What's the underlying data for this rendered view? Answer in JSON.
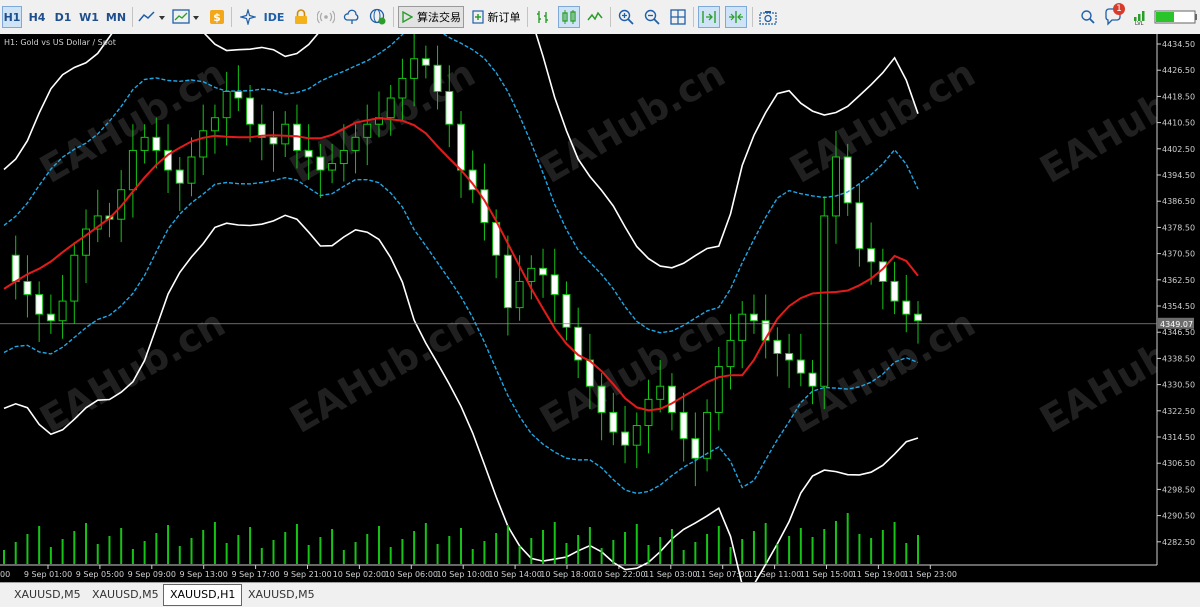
{
  "toolbar": {
    "timeframes": [
      "H1",
      "H4",
      "D1",
      "W1",
      "MN"
    ],
    "algo_label": "算法交易",
    "new_order_label": "新订单",
    "ide_label": "IDE",
    "notification_count": "1"
  },
  "chart": {
    "title": "H1: Gold vs US Dollar / Spot",
    "current_price": "4349.07",
    "price_levels": [
      "4434.50",
      "4426.50",
      "4418.50",
      "4410.50",
      "4402.50",
      "4394.50",
      "4386.50",
      "4378.50",
      "4370.50",
      "4362.50",
      "4354.50",
      "4346.50",
      "4338.50",
      "4330.50",
      "4322.50",
      "4314.50",
      "4306.50",
      "4298.50",
      "4290.50",
      "4282.50"
    ],
    "time_labels": [
      "9 Sep 01:00",
      "9 Sep 05:00",
      "9 Sep 09:00",
      "9 Sep 13:00",
      "9 Sep 17:00",
      "9 Sep 21:00",
      "10 Sep 02:00",
      "10 Sep 06:00",
      "10 Sep 10:00",
      "10 Sep 14:00",
      "10 Sep 18:00",
      "10 Sep 22:00",
      "11 Sep 03:00",
      "11 Sep 07:00",
      "11 Sep 11:00",
      "11 Sep 15:00",
      "11 Sep 19:00",
      "11 Sep 23:00"
    ],
    "time_label_left_partial": "00",
    "watermark": "EAHub.cn",
    "colors": {
      "background": "#000000",
      "middle_band": "#e31b1b",
      "inner_band": "#1fa7e5",
      "outer_band": "#ffffff",
      "volume": "#16c416",
      "bull_body": "#000000",
      "bear_body": "#ffffff",
      "wick": "#16c416"
    }
  },
  "tabs": [
    "XAUUSD,M5",
    "XAUUSD,M5",
    "XAUUSD,H1",
    "XAUUSD,M5"
  ],
  "active_tab_index": 2
}
